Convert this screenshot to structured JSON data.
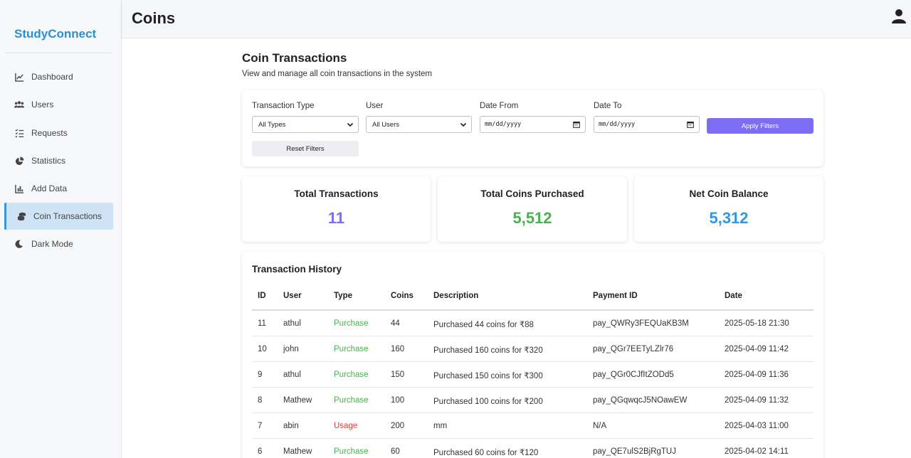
{
  "sidebar": {
    "brand": "StudyConnect",
    "items": [
      {
        "label": "Dashboard",
        "icon": "chart-line-icon"
      },
      {
        "label": "Users",
        "icon": "users-icon"
      },
      {
        "label": "Requests",
        "icon": "list-check-icon"
      },
      {
        "label": "Statistics",
        "icon": "pie-chart-icon"
      },
      {
        "label": "Add Data",
        "icon": "bar-chart-icon"
      },
      {
        "label": "Coin Transactions",
        "icon": "coins-icon",
        "active": true
      },
      {
        "label": "Dark Mode",
        "icon": "moon-icon"
      }
    ]
  },
  "header": {
    "title": "Coins",
    "user_icon": "user-icon"
  },
  "section": {
    "title": "Coin Transactions",
    "subtitle": "View and manage all coin transactions in the system"
  },
  "filters": {
    "transaction_type": {
      "label": "Transaction Type",
      "value": "All Types"
    },
    "user": {
      "label": "User",
      "value": "All Users"
    },
    "date_from": {
      "label": "Date From",
      "placeholder": "mm/dd/yyyy"
    },
    "date_to": {
      "label": "Date To",
      "placeholder": "mm/dd/yyyy"
    },
    "apply_label": "Apply Filters",
    "reset_label": "Reset Filters"
  },
  "stats": {
    "total_transactions": {
      "label": "Total Transactions",
      "value": "11"
    },
    "total_purchased": {
      "label": "Total Coins Purchased",
      "value": "5,512"
    },
    "net_balance": {
      "label": "Net Coin Balance",
      "value": "5,312"
    }
  },
  "colors": {
    "accent_purple": "#7d6df2",
    "green": "#4caf50",
    "blue": "#2e97e6",
    "red": "#e53935",
    "brand": "#2e8fd0"
  },
  "history": {
    "title": "Transaction History",
    "columns": [
      "ID",
      "User",
      "Type",
      "Coins",
      "Description",
      "Payment ID",
      "Date"
    ],
    "rows": [
      {
        "id": "11",
        "user": "athul",
        "type": "Purchase",
        "coins": "44",
        "description": "Purchased 44 coins for ₹88",
        "payment_id": "pay_QWRy3FEQUaKB3M",
        "date": "2025-05-18 21:30"
      },
      {
        "id": "10",
        "user": "john",
        "type": "Purchase",
        "coins": "160",
        "description": "Purchased 160 coins for ₹320",
        "payment_id": "pay_QGr7EETyLZlr76",
        "date": "2025-04-09 11:42"
      },
      {
        "id": "9",
        "user": "athul",
        "type": "Purchase",
        "coins": "150",
        "description": "Purchased 150 coins for ₹300",
        "payment_id": "pay_QGr0CJfItZODd5",
        "date": "2025-04-09 11:36"
      },
      {
        "id": "8",
        "user": "Mathew",
        "type": "Purchase",
        "coins": "100",
        "description": "Purchased 100 coins for ₹200",
        "payment_id": "pay_QGqwqcJ5NOawEW",
        "date": "2025-04-09 11:32"
      },
      {
        "id": "7",
        "user": "abin",
        "type": "Usage",
        "coins": "200",
        "description": "mm",
        "payment_id": "N/A",
        "date": "2025-04-03 11:00"
      },
      {
        "id": "6",
        "user": "Mathew",
        "type": "Purchase",
        "coins": "60",
        "description": "Purchased 60 coins for ₹120",
        "payment_id": "pay_QE7ulS2BjRgTUJ",
        "date": "2025-04-02 14:11"
      }
    ]
  }
}
